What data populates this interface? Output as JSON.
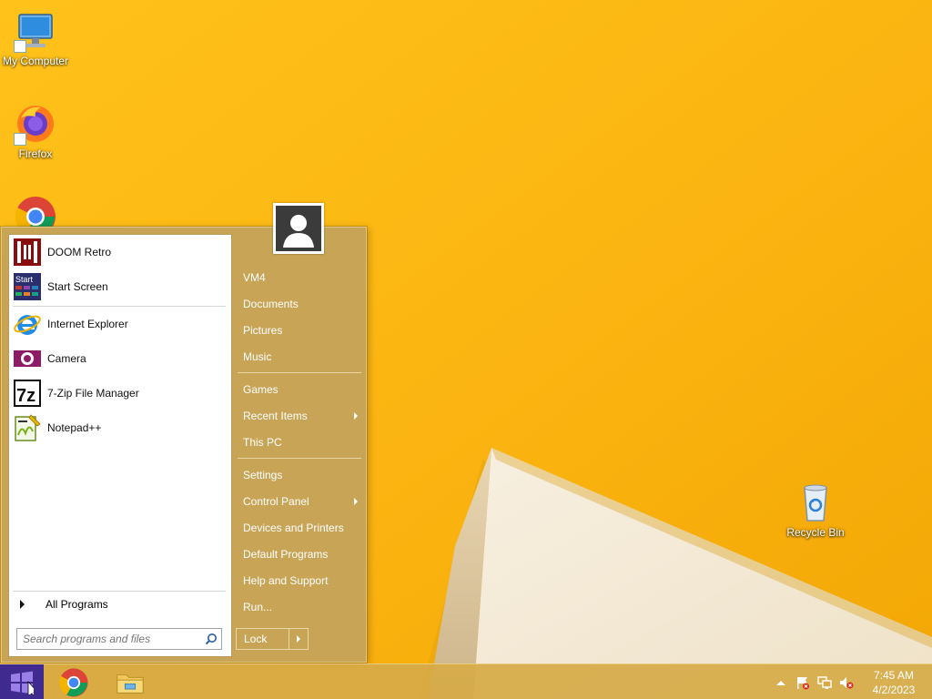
{
  "desktop": {
    "icons": [
      {
        "label": "My Computer"
      },
      {
        "label": "Firefox"
      },
      {
        "label": ""
      },
      {
        "label": "Recycle Bin"
      }
    ]
  },
  "start_menu": {
    "programs": [
      {
        "label": "DOOM Retro",
        "icon": "doom-retro-icon"
      },
      {
        "label": "Start Screen",
        "icon": "start-screen-icon"
      },
      {
        "label": "Internet Explorer",
        "icon": "internet-explorer-icon"
      },
      {
        "label": "Camera",
        "icon": "camera-icon"
      },
      {
        "label": "7-Zip File Manager",
        "icon": "7zip-icon"
      },
      {
        "label": "Notepad++",
        "icon": "notepadpp-icon"
      }
    ],
    "all_programs": "All Programs",
    "search_placeholder": "Search programs and files",
    "right_items": [
      {
        "label": "VM4"
      },
      {
        "label": "Documents"
      },
      {
        "label": "Pictures"
      },
      {
        "label": "Music"
      },
      {
        "label": "Games"
      },
      {
        "label": "Recent Items",
        "submenu": true
      },
      {
        "label": "This PC"
      },
      {
        "label": "Settings"
      },
      {
        "label": "Control Panel",
        "submenu": true
      },
      {
        "label": "Devices and Printers"
      },
      {
        "label": "Default Programs"
      },
      {
        "label": "Help and Support"
      },
      {
        "label": "Run..."
      }
    ],
    "lock_label": "Lock"
  },
  "taskbar": {
    "apps": [
      "chrome-icon",
      "file-explorer-icon"
    ],
    "tray_icons": [
      "show-hidden-icons-icon",
      "action-center-flag-icon",
      "network-icon",
      "volume-muted-icon"
    ],
    "clock_time": "7:45 AM",
    "clock_date": "4/2/2023"
  },
  "colors": {
    "wallpaper": "#f6b70a",
    "menu_accent": "#c8a556",
    "start_button": "#3f2b8f"
  }
}
